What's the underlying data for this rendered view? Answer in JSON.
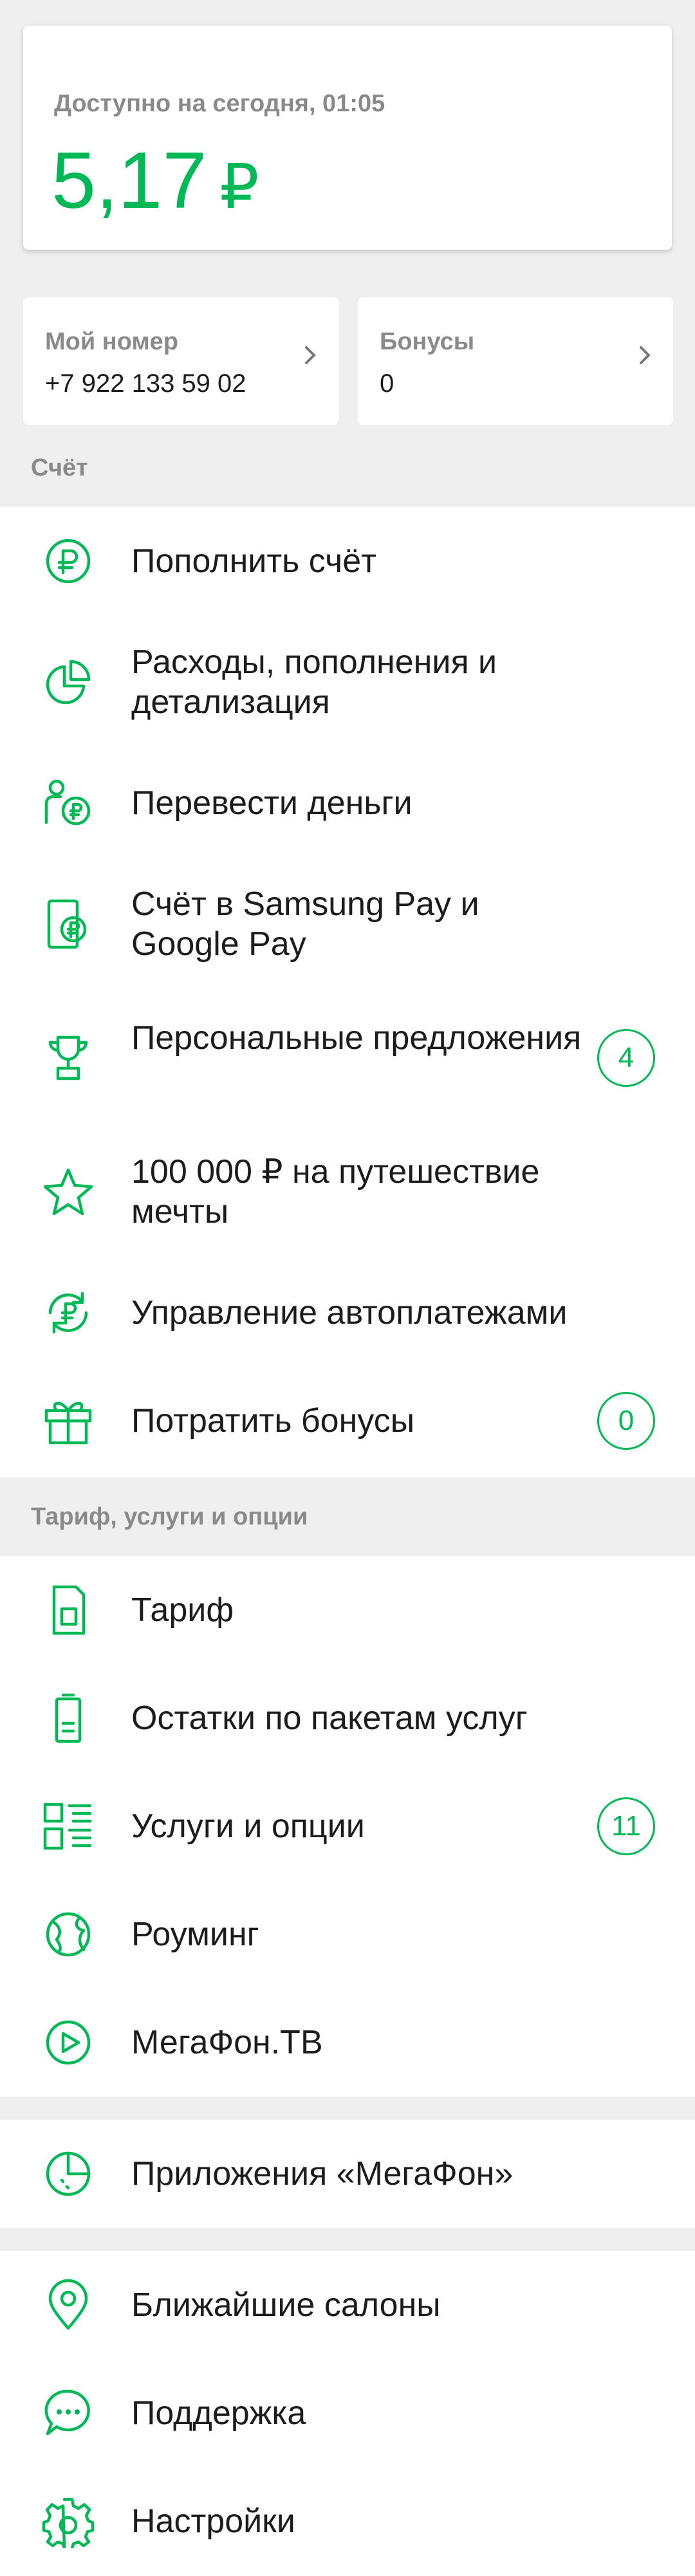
{
  "balance": {
    "label": "Доступно на сегодня, 01:05",
    "amount": "5,17",
    "currency": "₽"
  },
  "tiles": {
    "number": {
      "label": "Мой номер",
      "value": "+7 922 133 59 02"
    },
    "bonuses": {
      "label": "Бонусы",
      "value": "0"
    }
  },
  "sections": {
    "account": "Счёт",
    "tariff": "Тариф, услуги и опции"
  },
  "account_items": [
    {
      "label": "Пополнить счёт",
      "icon": "ruble-circle-icon"
    },
    {
      "label": "Расходы, пополнения и детализация",
      "icon": "pie-chart-icon"
    },
    {
      "label": "Перевести деньги",
      "icon": "transfer-money-icon"
    },
    {
      "label": "Счёт в Samsung Pay и Google Pay",
      "icon": "phone-pay-icon"
    },
    {
      "label": "Персональные предложения",
      "icon": "trophy-icon",
      "badge": "4"
    },
    {
      "label": "100 000 ₽ на путешествие мечты",
      "icon": "star-icon"
    },
    {
      "label": "Управление автоплатежами",
      "icon": "autopay-icon"
    },
    {
      "label": "Потратить бонусы",
      "icon": "gift-icon",
      "badge": "0"
    }
  ],
  "tariff_items": [
    {
      "label": "Тариф",
      "icon": "sim-card-icon"
    },
    {
      "label": "Остатки по пакетам услуг",
      "icon": "battery-icon"
    },
    {
      "label": "Услуги и опции",
      "icon": "services-list-icon",
      "badge": "11"
    },
    {
      "label": "Роуминг",
      "icon": "globe-icon"
    },
    {
      "label": "МегаФон.ТВ",
      "icon": "play-icon"
    }
  ],
  "apps_item": {
    "label": "Приложения «МегаФон»",
    "icon": "apps-icon"
  },
  "misc_items": [
    {
      "label": "Ближайшие салоны",
      "icon": "location-pin-icon"
    },
    {
      "label": "Поддержка",
      "icon": "chat-bubble-icon"
    },
    {
      "label": "Настройки",
      "icon": "gear-icon"
    }
  ],
  "colors": {
    "accent": "#00b956",
    "background": "#efefef",
    "muted": "#8a8a8a"
  }
}
